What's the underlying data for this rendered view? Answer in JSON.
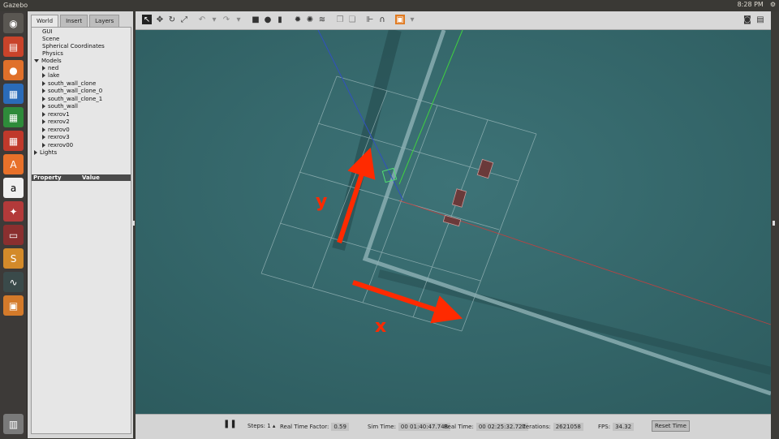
{
  "topbar": {
    "app_title": "Gazebo",
    "clock": "8:28 PM"
  },
  "launcher": {
    "items": [
      "ubuntu-dash",
      "files",
      "firefox",
      "libreoffice-writer",
      "libreoffice-calc",
      "libreoffice-impress",
      "software-center",
      "amazon",
      "system-settings",
      "terminal-app",
      "sublime",
      "system-monitor",
      "gazebo",
      "trash"
    ]
  },
  "tabs": {
    "world": "World",
    "insert": "Insert",
    "layers": "Layers"
  },
  "tree": {
    "gui": "GUI",
    "scene": "Scene",
    "spherical": "Spherical Coordinates",
    "physics": "Physics",
    "models": "Models",
    "model_items": [
      "ned",
      "lake",
      "south_wall_clone",
      "south_wall_clone_0",
      "south_wall_clone_1",
      "south_wall",
      "rexrov1",
      "rexrov2",
      "rexrov0",
      "rexrov3",
      "rexrov00"
    ],
    "lights": "Lights"
  },
  "properties": {
    "col1": "Property",
    "col2": "Value"
  },
  "viewport": {
    "label_y": "y",
    "label_x": "x",
    "arrow_color": "#ff2a00"
  },
  "bottom": {
    "steps_label": "Steps:",
    "steps_value": "1",
    "rtf_label": "Real Time Factor:",
    "rtf_value": "0.59",
    "simtime_label": "Sim Time:",
    "simtime_value": "00 01:40:47.748",
    "realtime_label": "Real Time:",
    "realtime_value": "00 02:25:32.727",
    "iterations_label": "Iterations:",
    "iterations_value": "2621058",
    "fps_label": "FPS:",
    "fps_value": "34.32",
    "reset_label": "Reset Time"
  }
}
